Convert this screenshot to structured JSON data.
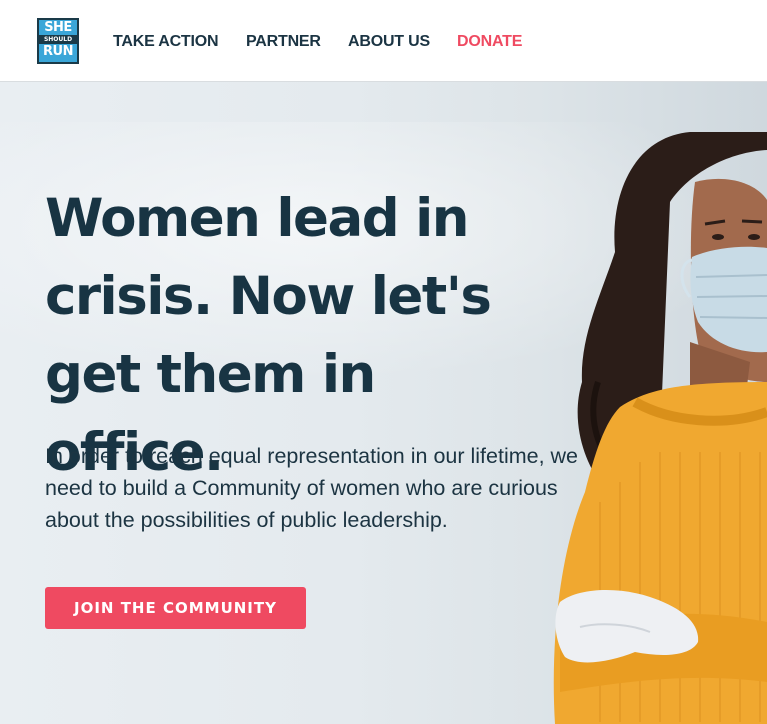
{
  "logo": {
    "line1": "SHE",
    "line2": "SHOULD",
    "line3": "RUN"
  },
  "nav": {
    "items": [
      {
        "label": "TAKE ACTION"
      },
      {
        "label": "PARTNER"
      },
      {
        "label": "ABOUT US"
      },
      {
        "label": "DONATE"
      }
    ]
  },
  "hero": {
    "headline": "Women lead in crisis. Now let's get them in office.",
    "intro": "In order to reach equal representation in our lifetime, we need to build a Community of women who are curious about the possibilities of public leadership.",
    "cta_label": "JOIN THE COMMUNITY"
  },
  "colors": {
    "accent": "#ef4a61",
    "text": "#183443",
    "sweater": "#f0a830",
    "logo_blue": "#3aa6d8"
  }
}
